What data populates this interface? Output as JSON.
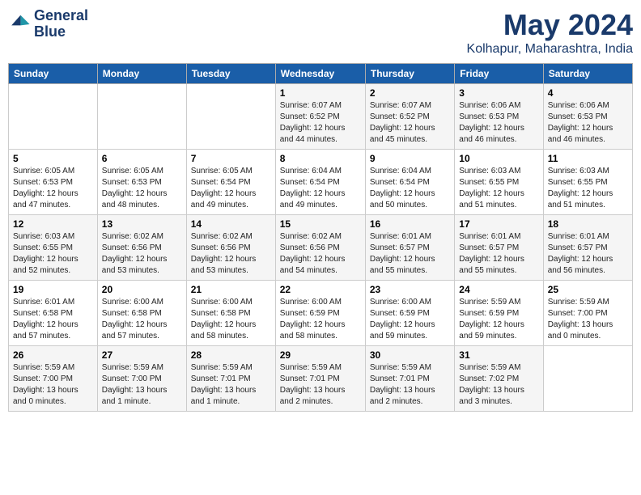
{
  "logo": {
    "line1": "General",
    "line2": "Blue"
  },
  "title": "May 2024",
  "location": "Kolhapur, Maharashtra, India",
  "days_of_week": [
    "Sunday",
    "Monday",
    "Tuesday",
    "Wednesday",
    "Thursday",
    "Friday",
    "Saturday"
  ],
  "weeks": [
    [
      {
        "day": "",
        "info": ""
      },
      {
        "day": "",
        "info": ""
      },
      {
        "day": "",
        "info": ""
      },
      {
        "day": "1",
        "info": "Sunrise: 6:07 AM\nSunset: 6:52 PM\nDaylight: 12 hours\nand 44 minutes."
      },
      {
        "day": "2",
        "info": "Sunrise: 6:07 AM\nSunset: 6:52 PM\nDaylight: 12 hours\nand 45 minutes."
      },
      {
        "day": "3",
        "info": "Sunrise: 6:06 AM\nSunset: 6:53 PM\nDaylight: 12 hours\nand 46 minutes."
      },
      {
        "day": "4",
        "info": "Sunrise: 6:06 AM\nSunset: 6:53 PM\nDaylight: 12 hours\nand 46 minutes."
      }
    ],
    [
      {
        "day": "5",
        "info": "Sunrise: 6:05 AM\nSunset: 6:53 PM\nDaylight: 12 hours\nand 47 minutes."
      },
      {
        "day": "6",
        "info": "Sunrise: 6:05 AM\nSunset: 6:53 PM\nDaylight: 12 hours\nand 48 minutes."
      },
      {
        "day": "7",
        "info": "Sunrise: 6:05 AM\nSunset: 6:54 PM\nDaylight: 12 hours\nand 49 minutes."
      },
      {
        "day": "8",
        "info": "Sunrise: 6:04 AM\nSunset: 6:54 PM\nDaylight: 12 hours\nand 49 minutes."
      },
      {
        "day": "9",
        "info": "Sunrise: 6:04 AM\nSunset: 6:54 PM\nDaylight: 12 hours\nand 50 minutes."
      },
      {
        "day": "10",
        "info": "Sunrise: 6:03 AM\nSunset: 6:55 PM\nDaylight: 12 hours\nand 51 minutes."
      },
      {
        "day": "11",
        "info": "Sunrise: 6:03 AM\nSunset: 6:55 PM\nDaylight: 12 hours\nand 51 minutes."
      }
    ],
    [
      {
        "day": "12",
        "info": "Sunrise: 6:03 AM\nSunset: 6:55 PM\nDaylight: 12 hours\nand 52 minutes."
      },
      {
        "day": "13",
        "info": "Sunrise: 6:02 AM\nSunset: 6:56 PM\nDaylight: 12 hours\nand 53 minutes."
      },
      {
        "day": "14",
        "info": "Sunrise: 6:02 AM\nSunset: 6:56 PM\nDaylight: 12 hours\nand 53 minutes."
      },
      {
        "day": "15",
        "info": "Sunrise: 6:02 AM\nSunset: 6:56 PM\nDaylight: 12 hours\nand 54 minutes."
      },
      {
        "day": "16",
        "info": "Sunrise: 6:01 AM\nSunset: 6:57 PM\nDaylight: 12 hours\nand 55 minutes."
      },
      {
        "day": "17",
        "info": "Sunrise: 6:01 AM\nSunset: 6:57 PM\nDaylight: 12 hours\nand 55 minutes."
      },
      {
        "day": "18",
        "info": "Sunrise: 6:01 AM\nSunset: 6:57 PM\nDaylight: 12 hours\nand 56 minutes."
      }
    ],
    [
      {
        "day": "19",
        "info": "Sunrise: 6:01 AM\nSunset: 6:58 PM\nDaylight: 12 hours\nand 57 minutes."
      },
      {
        "day": "20",
        "info": "Sunrise: 6:00 AM\nSunset: 6:58 PM\nDaylight: 12 hours\nand 57 minutes."
      },
      {
        "day": "21",
        "info": "Sunrise: 6:00 AM\nSunset: 6:58 PM\nDaylight: 12 hours\nand 58 minutes."
      },
      {
        "day": "22",
        "info": "Sunrise: 6:00 AM\nSunset: 6:59 PM\nDaylight: 12 hours\nand 58 minutes."
      },
      {
        "day": "23",
        "info": "Sunrise: 6:00 AM\nSunset: 6:59 PM\nDaylight: 12 hours\nand 59 minutes."
      },
      {
        "day": "24",
        "info": "Sunrise: 5:59 AM\nSunset: 6:59 PM\nDaylight: 12 hours\nand 59 minutes."
      },
      {
        "day": "25",
        "info": "Sunrise: 5:59 AM\nSunset: 7:00 PM\nDaylight: 13 hours\nand 0 minutes."
      }
    ],
    [
      {
        "day": "26",
        "info": "Sunrise: 5:59 AM\nSunset: 7:00 PM\nDaylight: 13 hours\nand 0 minutes."
      },
      {
        "day": "27",
        "info": "Sunrise: 5:59 AM\nSunset: 7:00 PM\nDaylight: 13 hours\nand 1 minute."
      },
      {
        "day": "28",
        "info": "Sunrise: 5:59 AM\nSunset: 7:01 PM\nDaylight: 13 hours\nand 1 minute."
      },
      {
        "day": "29",
        "info": "Sunrise: 5:59 AM\nSunset: 7:01 PM\nDaylight: 13 hours\nand 2 minutes."
      },
      {
        "day": "30",
        "info": "Sunrise: 5:59 AM\nSunset: 7:01 PM\nDaylight: 13 hours\nand 2 minutes."
      },
      {
        "day": "31",
        "info": "Sunrise: 5:59 AM\nSunset: 7:02 PM\nDaylight: 13 hours\nand 3 minutes."
      },
      {
        "day": "",
        "info": ""
      }
    ]
  ]
}
